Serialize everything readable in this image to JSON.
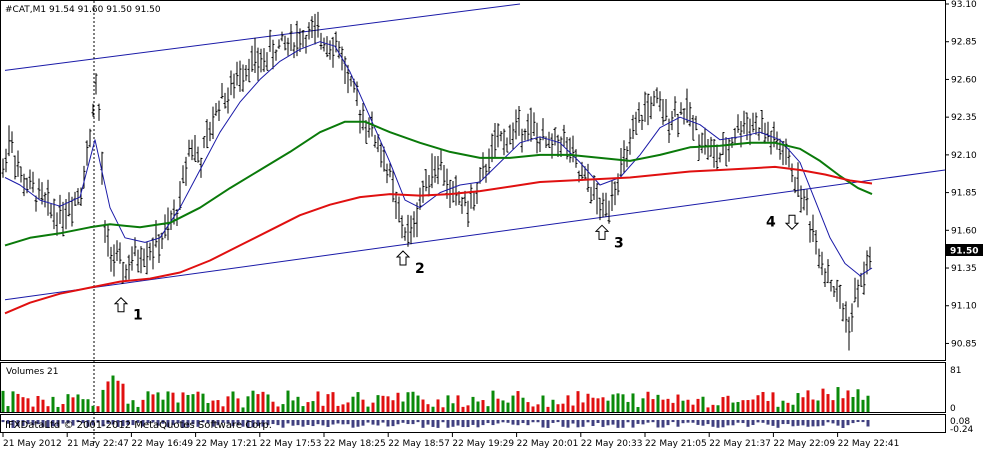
{
  "header": {
    "symbol_line": "#CAT,M1  91.54 91.60 91.50 91.50",
    "volumes_label": "Volumes 21",
    "copyright": "IFXDataLtd © 2001-2012 MetaQuotes Software Corp."
  },
  "price_axis": {
    "ticks": [
      "93.10",
      "92.85",
      "92.60",
      "92.35",
      "92.10",
      "91.85",
      "91.60",
      "91.35",
      "91.10",
      "90.85"
    ],
    "current": "91.50"
  },
  "volume_axis": {
    "ticks": [
      "81",
      "0"
    ]
  },
  "indicator_axis": {
    "top": "0.08",
    "bottom": "-0.24"
  },
  "time_axis": {
    "labels": [
      "21 May 2012",
      "21 May 22:47",
      "22 May 16:49",
      "22 May 17:21",
      "22 May 17:53",
      "22 May 18:25",
      "22 May 18:57",
      "22 May 19:29",
      "22 May 20:01",
      "22 May 20:33",
      "22 May 21:05",
      "22 May 21:37",
      "22 May 22:09",
      "22 May 22:41"
    ]
  },
  "annotations": [
    {
      "label": "1",
      "arrow": "up"
    },
    {
      "label": "2",
      "arrow": "up"
    },
    {
      "label": "3",
      "arrow": "up"
    },
    {
      "label": "4",
      "arrow": "down"
    }
  ],
  "colors": {
    "bars": "#000000",
    "fast_ma": "#1a1aa8",
    "mid_ma": "#0a7a0a",
    "slow_ma": "#e01010",
    "channel": "#1a1aa8",
    "vol_up": "#0a8a0a",
    "vol_down": "#e01010",
    "separator": "#000000"
  },
  "chart_data": {
    "type": "ohlc",
    "symbol": "#CAT",
    "timeframe": "M1",
    "last_quote": {
      "open": 91.54,
      "high": 91.6,
      "low": 91.5,
      "close": 91.5
    },
    "ylim": [
      90.8,
      93.1
    ],
    "price_path": [
      [
        0,
        91.88
      ],
      [
        10,
        92.25
      ],
      [
        20,
        91.95
      ],
      [
        30,
        91.88
      ],
      [
        40,
        91.82
      ],
      [
        50,
        91.74
      ],
      [
        60,
        91.7
      ],
      [
        70,
        91.78
      ],
      [
        80,
        91.86
      ],
      [
        90,
        92.2
      ],
      [
        95,
        92.62
      ],
      [
        100,
        92.3
      ],
      [
        105,
        91.55
      ],
      [
        115,
        91.4
      ],
      [
        125,
        91.33
      ],
      [
        135,
        91.42
      ],
      [
        150,
        91.48
      ],
      [
        160,
        91.52
      ],
      [
        170,
        91.62
      ],
      [
        180,
        91.8
      ],
      [
        190,
        92.2
      ],
      [
        200,
        92.05
      ],
      [
        210,
        92.25
      ],
      [
        220,
        92.48
      ],
      [
        230,
        92.5
      ],
      [
        240,
        92.65
      ],
      [
        250,
        92.72
      ],
      [
        260,
        92.7
      ],
      [
        270,
        92.78
      ],
      [
        280,
        92.82
      ],
      [
        290,
        92.85
      ],
      [
        300,
        92.88
      ],
      [
        310,
        92.9
      ],
      [
        320,
        92.88
      ],
      [
        330,
        92.86
      ],
      [
        340,
        92.8
      ],
      [
        350,
        92.55
      ],
      [
        360,
        92.4
      ],
      [
        370,
        92.28
      ],
      [
        380,
        92.15
      ],
      [
        390,
        91.95
      ],
      [
        400,
        91.65
      ],
      [
        410,
        91.55
      ],
      [
        420,
        91.8
      ],
      [
        430,
        92.0
      ],
      [
        440,
        92.05
      ],
      [
        450,
        91.85
      ],
      [
        460,
        91.8
      ],
      [
        470,
        91.75
      ],
      [
        480,
        91.9
      ],
      [
        490,
        92.1
      ],
      [
        500,
        92.2
      ],
      [
        510,
        92.22
      ],
      [
        520,
        92.3
      ],
      [
        530,
        92.28
      ],
      [
        540,
        92.2
      ],
      [
        550,
        92.15
      ],
      [
        560,
        92.22
      ],
      [
        570,
        92.12
      ],
      [
        580,
        91.95
      ],
      [
        590,
        91.9
      ],
      [
        600,
        91.75
      ],
      [
        605,
        91.72
      ],
      [
        615,
        91.92
      ],
      [
        625,
        92.05
      ],
      [
        635,
        92.25
      ],
      [
        645,
        92.4
      ],
      [
        655,
        92.45
      ],
      [
        665,
        92.35
      ],
      [
        675,
        92.38
      ],
      [
        685,
        92.4
      ],
      [
        695,
        92.28
      ],
      [
        705,
        92.18
      ],
      [
        715,
        92.08
      ],
      [
        725,
        92.1
      ],
      [
        735,
        92.25
      ],
      [
        745,
        92.32
      ],
      [
        755,
        92.3
      ],
      [
        765,
        92.25
      ],
      [
        775,
        92.18
      ],
      [
        785,
        92.1
      ],
      [
        795,
        91.95
      ],
      [
        805,
        91.78
      ],
      [
        815,
        91.55
      ],
      [
        825,
        91.35
      ],
      [
        835,
        91.2
      ],
      [
        845,
        91.05
      ],
      [
        850,
        90.95
      ],
      [
        855,
        91.15
      ],
      [
        865,
        91.3
      ],
      [
        872,
        91.55
      ]
    ],
    "series": [
      {
        "style": "ma-fast",
        "points": [
          [
            5,
            91.95
          ],
          [
            20,
            91.9
          ],
          [
            40,
            91.8
          ],
          [
            60,
            91.76
          ],
          [
            80,
            91.82
          ],
          [
            95,
            92.2
          ],
          [
            110,
            91.75
          ],
          [
            125,
            91.55
          ],
          [
            145,
            91.52
          ],
          [
            160,
            91.55
          ],
          [
            180,
            91.75
          ],
          [
            200,
            92.0
          ],
          [
            220,
            92.25
          ],
          [
            240,
            92.45
          ],
          [
            260,
            92.6
          ],
          [
            280,
            92.72
          ],
          [
            300,
            92.8
          ],
          [
            320,
            92.85
          ],
          [
            335,
            92.82
          ],
          [
            350,
            92.65
          ],
          [
            370,
            92.35
          ],
          [
            390,
            92.05
          ],
          [
            405,
            91.8
          ],
          [
            420,
            91.75
          ],
          [
            440,
            91.85
          ],
          [
            460,
            91.9
          ],
          [
            480,
            91.92
          ],
          [
            500,
            92.05
          ],
          [
            520,
            92.18
          ],
          [
            540,
            92.22
          ],
          [
            560,
            92.18
          ],
          [
            580,
            92.05
          ],
          [
            600,
            91.9
          ],
          [
            620,
            91.95
          ],
          [
            640,
            92.1
          ],
          [
            660,
            92.28
          ],
          [
            680,
            92.35
          ],
          [
            700,
            92.3
          ],
          [
            720,
            92.2
          ],
          [
            740,
            92.22
          ],
          [
            760,
            92.25
          ],
          [
            780,
            92.2
          ],
          [
            800,
            92.05
          ],
          [
            815,
            91.8
          ],
          [
            830,
            91.55
          ],
          [
            845,
            91.38
          ],
          [
            860,
            91.3
          ],
          [
            872,
            91.35
          ]
        ]
      },
      {
        "style": "ma-mid",
        "points": [
          [
            5,
            91.5
          ],
          [
            30,
            91.55
          ],
          [
            60,
            91.58
          ],
          [
            90,
            91.62
          ],
          [
            110,
            91.64
          ],
          [
            140,
            91.62
          ],
          [
            170,
            91.65
          ],
          [
            200,
            91.75
          ],
          [
            230,
            91.88
          ],
          [
            260,
            92.0
          ],
          [
            290,
            92.12
          ],
          [
            320,
            92.25
          ],
          [
            345,
            92.32
          ],
          [
            365,
            92.32
          ],
          [
            390,
            92.25
          ],
          [
            420,
            92.18
          ],
          [
            450,
            92.12
          ],
          [
            480,
            92.08
          ],
          [
            510,
            92.08
          ],
          [
            540,
            92.1
          ],
          [
            570,
            92.1
          ],
          [
            600,
            92.08
          ],
          [
            630,
            92.06
          ],
          [
            660,
            92.1
          ],
          [
            690,
            92.15
          ],
          [
            720,
            92.16
          ],
          [
            750,
            92.18
          ],
          [
            775,
            92.18
          ],
          [
            800,
            92.14
          ],
          [
            820,
            92.06
          ],
          [
            840,
            91.96
          ],
          [
            858,
            91.88
          ],
          [
            872,
            91.84
          ]
        ]
      },
      {
        "style": "ma-slow",
        "points": [
          [
            5,
            91.05
          ],
          [
            30,
            91.12
          ],
          [
            60,
            91.18
          ],
          [
            90,
            91.22
          ],
          [
            120,
            91.26
          ],
          [
            150,
            91.28
          ],
          [
            180,
            91.32
          ],
          [
            210,
            91.4
          ],
          [
            240,
            91.5
          ],
          [
            270,
            91.6
          ],
          [
            300,
            91.7
          ],
          [
            330,
            91.77
          ],
          [
            360,
            91.82
          ],
          [
            390,
            91.84
          ],
          [
            420,
            91.83
          ],
          [
            450,
            91.84
          ],
          [
            480,
            91.86
          ],
          [
            510,
            91.89
          ],
          [
            540,
            91.92
          ],
          [
            570,
            91.93
          ],
          [
            600,
            91.94
          ],
          [
            630,
            91.95
          ],
          [
            660,
            91.97
          ],
          [
            690,
            91.99
          ],
          [
            720,
            92.0
          ],
          [
            750,
            92.01
          ],
          [
            775,
            92.02
          ],
          [
            800,
            92.0
          ],
          [
            825,
            91.97
          ],
          [
            850,
            91.93
          ],
          [
            872,
            91.91
          ]
        ]
      }
    ],
    "trendlines": [
      {
        "from": [
          5,
          92.66
        ],
        "to": [
          520,
          93.1
        ]
      },
      {
        "from": [
          5,
          91.14
        ],
        "to": [
          945,
          92.0
        ]
      }
    ],
    "marker_vline_x": 94,
    "arrows": [
      {
        "label": "1",
        "dir": "up",
        "x": 121,
        "y": 91.1
      },
      {
        "label": "2",
        "dir": "up",
        "x": 403,
        "y": 91.41
      },
      {
        "label": "3",
        "dir": "up",
        "x": 602,
        "y": 91.58
      },
      {
        "label": "4",
        "dir": "down",
        "x": 792,
        "y": 91.66
      }
    ],
    "volume": {
      "ylim": [
        0,
        81
      ],
      "count": 174,
      "seed": 7
    },
    "grid": false,
    "legend": "none"
  }
}
